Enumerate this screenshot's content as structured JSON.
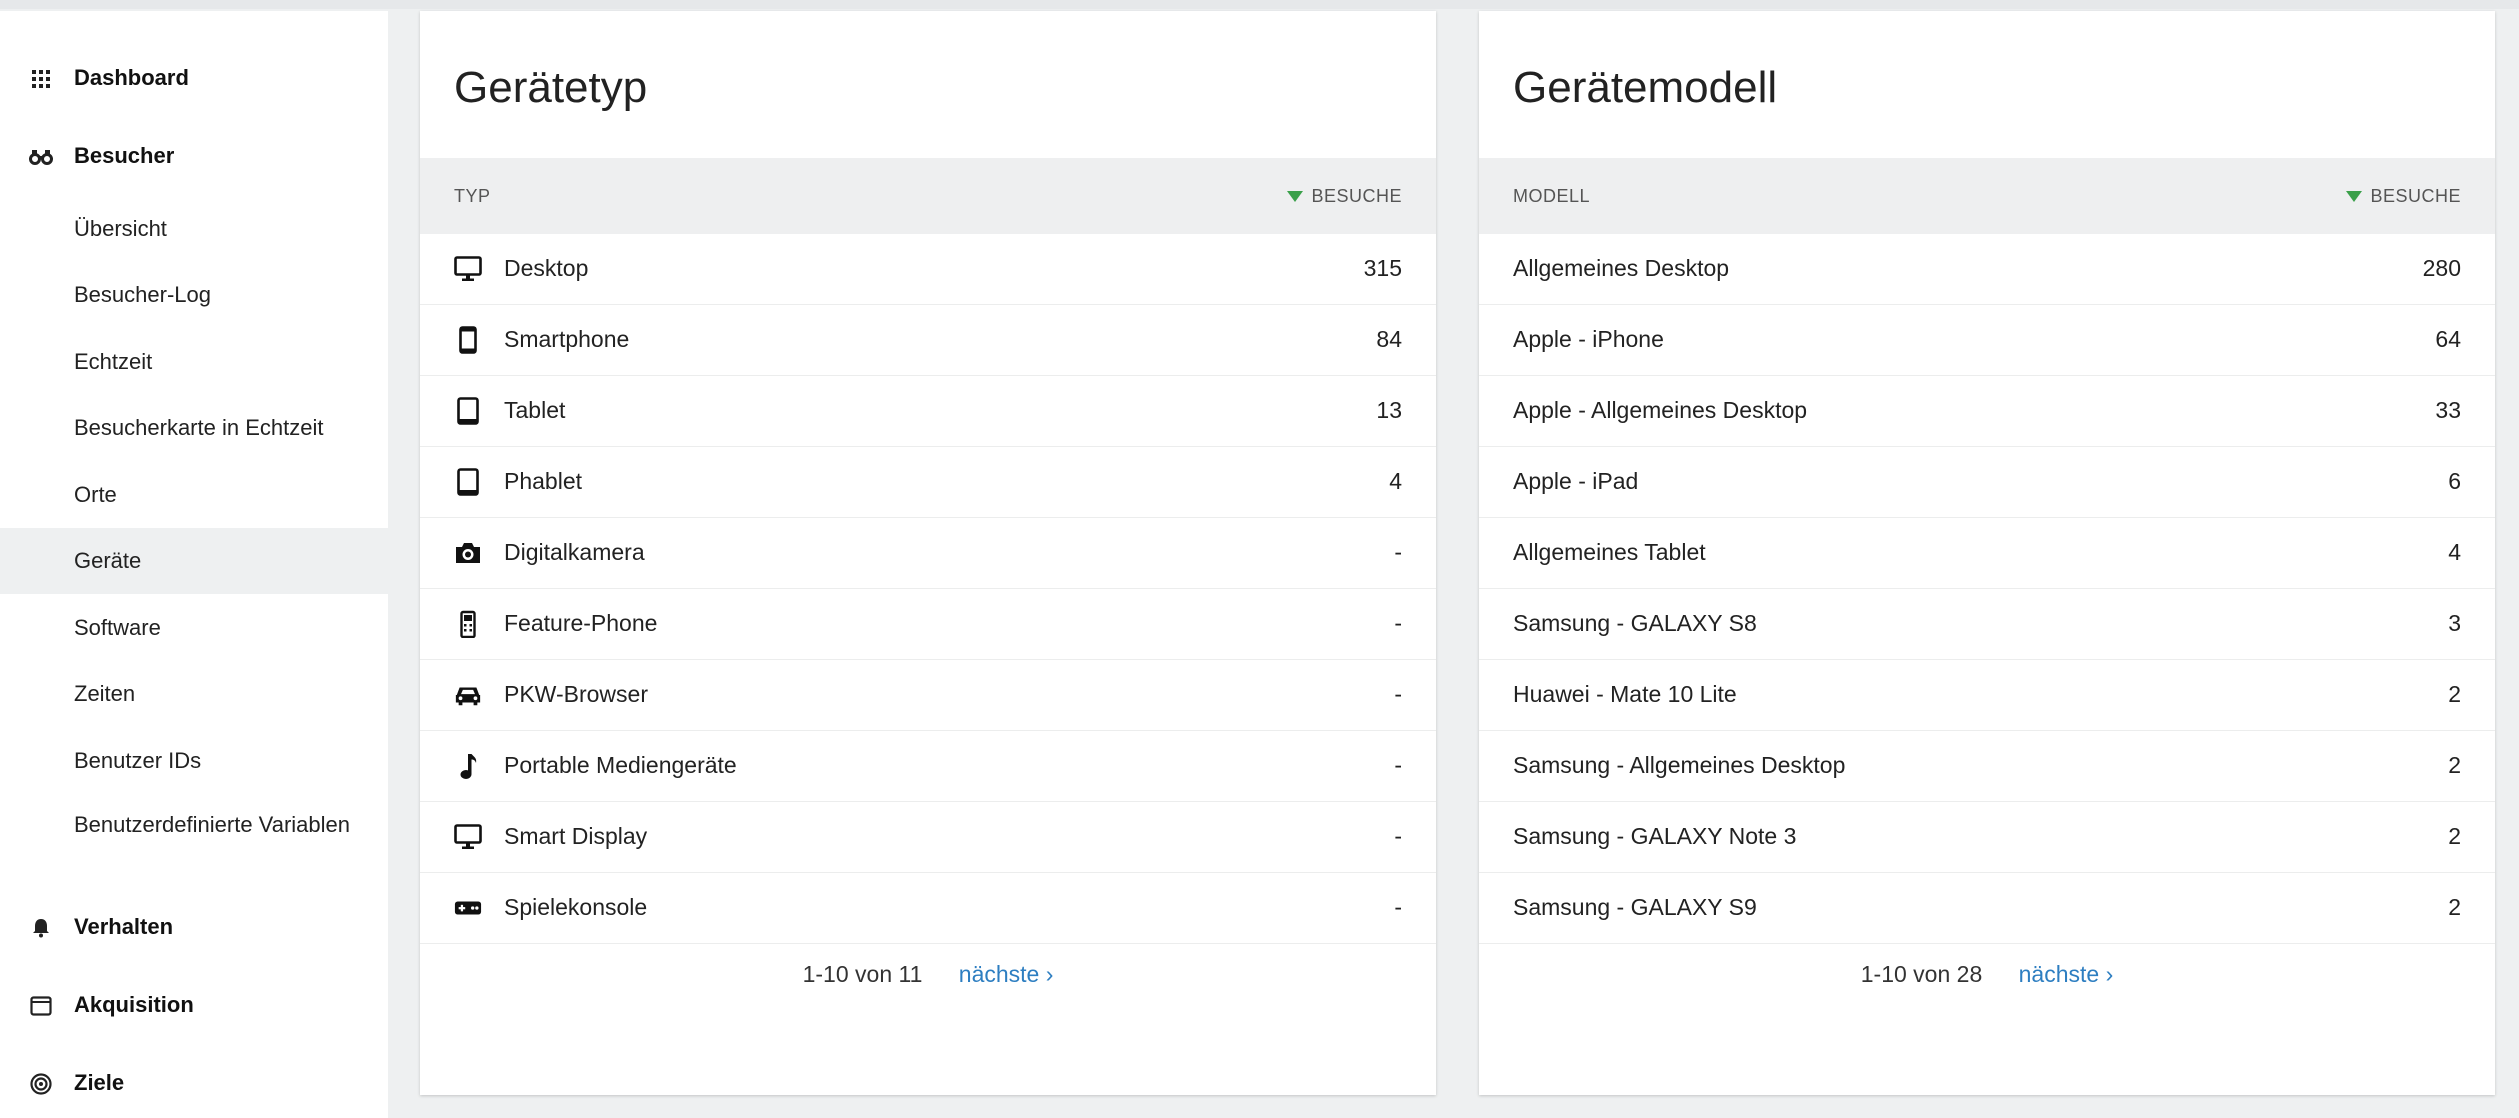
{
  "sidebar": {
    "categories": [
      {
        "label": "Dashboard",
        "icon": "grid-icon"
      },
      {
        "label": "Besucher",
        "icon": "binoculars-icon"
      },
      {
        "label": "Verhalten",
        "icon": "bell-icon"
      },
      {
        "label": "Akquisition",
        "icon": "window-icon"
      },
      {
        "label": "Ziele",
        "icon": "target-icon"
      }
    ],
    "subitems": [
      {
        "label": "Übersicht"
      },
      {
        "label": "Besucher-Log"
      },
      {
        "label": "Echtzeit"
      },
      {
        "label": "Besucherkarte in Echtzeit"
      },
      {
        "label": "Orte"
      },
      {
        "label": "Geräte",
        "active": true
      },
      {
        "label": "Software"
      },
      {
        "label": "Zeiten"
      },
      {
        "label": "Benutzer IDs"
      },
      {
        "label": "Benutzerdefinierte Variablen"
      }
    ]
  },
  "device_type": {
    "title": "Gerätetyp",
    "col_left": "TYP",
    "col_right": "BESUCHE",
    "rows": [
      {
        "label": "Desktop",
        "value": "315",
        "icon": "monitor-icon"
      },
      {
        "label": "Smartphone",
        "value": "84",
        "icon": "smartphone-icon"
      },
      {
        "label": "Tablet",
        "value": "13",
        "icon": "tablet-icon"
      },
      {
        "label": "Phablet",
        "value": "4",
        "icon": "phablet-icon"
      },
      {
        "label": "Digitalkamera",
        "value": "-",
        "icon": "camera-icon"
      },
      {
        "label": "Feature-Phone",
        "value": "-",
        "icon": "feature-phone-icon"
      },
      {
        "label": "PKW-Browser",
        "value": "-",
        "icon": "car-icon"
      },
      {
        "label": "Portable Mediengeräte",
        "value": "-",
        "icon": "music-note-icon"
      },
      {
        "label": "Smart Display",
        "value": "-",
        "icon": "display-icon"
      },
      {
        "label": "Spielekonsole",
        "value": "-",
        "icon": "gamepad-icon"
      }
    ],
    "pager_text": "1-10 von 11",
    "next_label": "nächste ›"
  },
  "device_model": {
    "title": "Gerätemodell",
    "col_left": "MODELL",
    "col_right": "BESUCHE",
    "rows": [
      {
        "label": "Allgemeines Desktop",
        "value": "280"
      },
      {
        "label": "Apple - iPhone",
        "value": "64"
      },
      {
        "label": "Apple - Allgemeines Desktop",
        "value": "33"
      },
      {
        "label": "Apple - iPad",
        "value": "6"
      },
      {
        "label": "Allgemeines Tablet",
        "value": "4"
      },
      {
        "label": "Samsung - GALAXY S8",
        "value": "3"
      },
      {
        "label": "Huawei - Mate 10 Lite",
        "value": "2"
      },
      {
        "label": "Samsung - Allgemeines Desktop",
        "value": "2"
      },
      {
        "label": "Samsung - GALAXY Note 3",
        "value": "2"
      },
      {
        "label": "Samsung - GALAXY S9",
        "value": "2"
      }
    ],
    "pager_text": "1-10 von 28",
    "next_label": "nächste ›"
  },
  "colors": {
    "accent": "#2d7ec1",
    "sort_indicator": "#3aa04a",
    "active_bg": "#eef0f1"
  }
}
